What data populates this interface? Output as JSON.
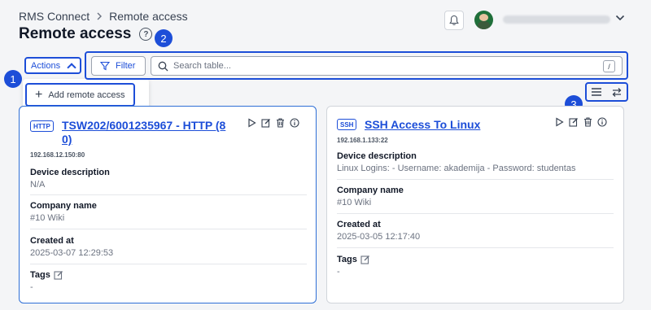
{
  "breadcrumb": {
    "root": "RMS Connect",
    "current": "Remote access"
  },
  "page": {
    "title": "Remote access"
  },
  "actions": {
    "label": "Actions",
    "menu": {
      "add_label": "Add remote access"
    }
  },
  "toolbar": {
    "filter_label": "Filter",
    "search_placeholder": "Search table...",
    "search_shortcut": "/"
  },
  "annotations": {
    "badge_1": "1",
    "badge_2": "2",
    "badge_3": "3"
  },
  "cards": [
    {
      "protocol": "HTTP",
      "title_line1": "TSW202/6001235967 - HTTP (8",
      "title_line2": "0)",
      "ip": "192.168.12.150:80",
      "device_description_label": "Device description",
      "device_description": "N/A",
      "company_label": "Company name",
      "company": "#10 Wiki",
      "created_label": "Created at",
      "created": "2025-03-07 12:29:53",
      "tags_label": "Tags",
      "tags": "-"
    },
    {
      "protocol": "SSH",
      "title": "SSH Access To Linux",
      "ip": "192.168.1.133:22",
      "device_description_label": "Device description",
      "device_description": "Linux Logins: - Username: akademija - Password: studentas",
      "company_label": "Company name",
      "company": "#10 Wiki",
      "created_label": "Created at",
      "created": "2025-03-05 12:17:40",
      "tags_label": "Tags",
      "tags": "-"
    }
  ],
  "colors": {
    "accent": "#1d4ed8",
    "background": "#f4f5f7",
    "card_border_active": "#2f6fd6"
  },
  "icons": [
    "chevron-right-icon",
    "help-icon",
    "bell-icon",
    "avatar",
    "chevron-down-icon",
    "chevron-up-icon",
    "plus-icon",
    "filter-icon",
    "search-icon",
    "list-view-icon",
    "sync-icon",
    "play-icon",
    "edit-icon",
    "delete-icon",
    "info-icon",
    "tag-edit-icon"
  ]
}
